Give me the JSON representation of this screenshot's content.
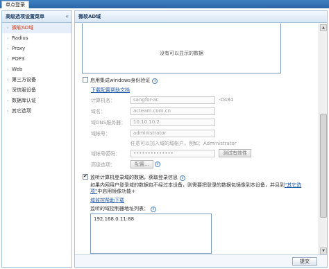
{
  "top_tab": "单点登录",
  "sidebar": {
    "title": "高级选项设置菜单",
    "collapse_icon": "«",
    "items": [
      {
        "label": "微软AD域",
        "active": true
      },
      {
        "label": "Radius",
        "active": false
      },
      {
        "label": "Proxy",
        "active": false
      },
      {
        "label": "POP3",
        "active": false
      },
      {
        "label": "Web",
        "active": false
      },
      {
        "label": "第三方设备",
        "active": false
      },
      {
        "label": "深信服设备",
        "active": false
      },
      {
        "label": "数据库认证",
        "active": false
      },
      {
        "label": "其它选项",
        "active": false
      }
    ]
  },
  "main": {
    "title": "微软AD域",
    "empty_text": "没有可以显示的数据",
    "win_auth": {
      "checkbox_label": "启用集成windows身份验证",
      "checked": false,
      "doc_link": "下载配置帮助文档",
      "fields": {
        "computer_name": {
          "label": "计算机名：",
          "value": "sangfor-ac",
          "suffix": "-D484"
        },
        "domain": {
          "label": "域名：",
          "value": "acteam.com.cn"
        },
        "dns": {
          "label": "域DNS服务器：",
          "value": "10.10.10.2"
        },
        "account": {
          "label": "域帐号：",
          "value": "administrator"
        },
        "hint": "任意可以加入域的域帐户，例如：Administrator",
        "password": {
          "label": "域帐号密码：",
          "value": "••••••••••••••"
        },
        "test_button": "测试有效性",
        "advanced": {
          "label": "高级选项：",
          "button": "配置..."
        }
      }
    },
    "monitor": {
      "checkbox_label": "监听计算机登录域的数据，获取登录信息",
      "checked": true,
      "desc_before": "如果内网用户登录域的数据包不经过本设备，则需要把登录的数据包镜像到本设备，并且到",
      "desc_link": "\"其它选项\"",
      "desc_after": "中启用镜像功能+",
      "download_link": "域监控帮助下载",
      "list_label": "监听的域控制器地址列表：",
      "ip_list": [
        "192.168.0.11:88"
      ]
    },
    "submit": "提交"
  }
}
